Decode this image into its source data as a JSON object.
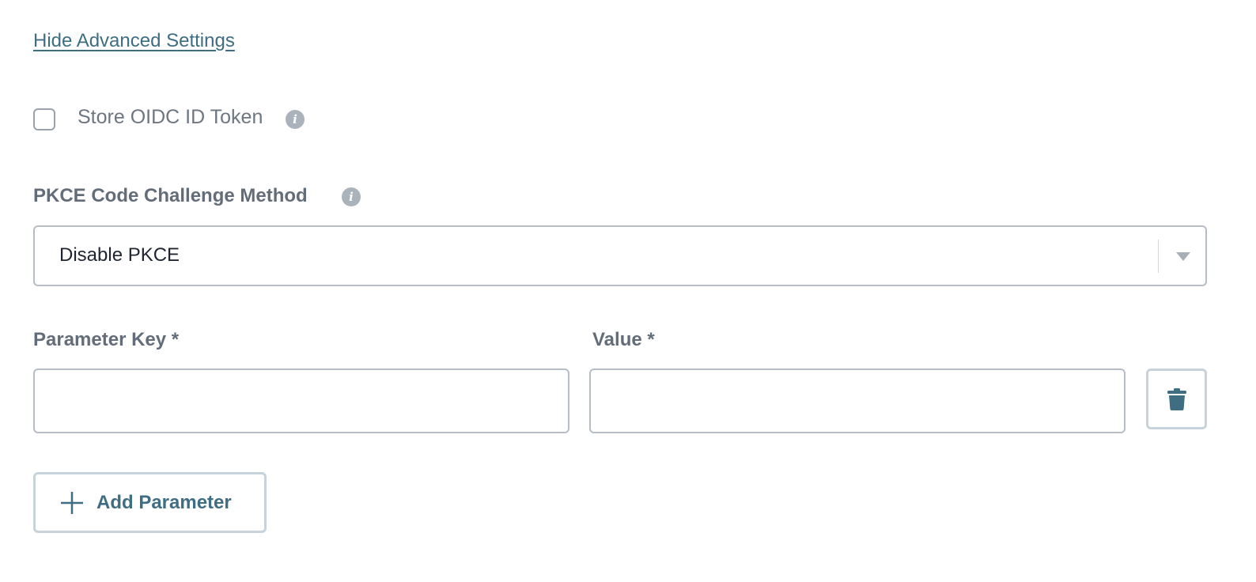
{
  "advanced_settings": {
    "toggle_link": "Hide Advanced Settings"
  },
  "store_token": {
    "label": "Store OIDC ID Token",
    "checked": false,
    "info_icon": "info-icon"
  },
  "pkce": {
    "label": "PKCE Code Challenge Method",
    "info_icon": "info-icon",
    "selected": "Disable PKCE"
  },
  "parameters": {
    "key_label": "Parameter Key *",
    "value_label": "Value *",
    "rows": [
      {
        "key": "",
        "value": ""
      }
    ],
    "delete_icon": "trash-icon",
    "add_icon": "plus-icon",
    "add_label": "Add Parameter"
  },
  "colors": {
    "accent": "#3f6e82",
    "label": "#636d79",
    "border": "#b6bdc5",
    "button_border": "#c6d3da"
  }
}
